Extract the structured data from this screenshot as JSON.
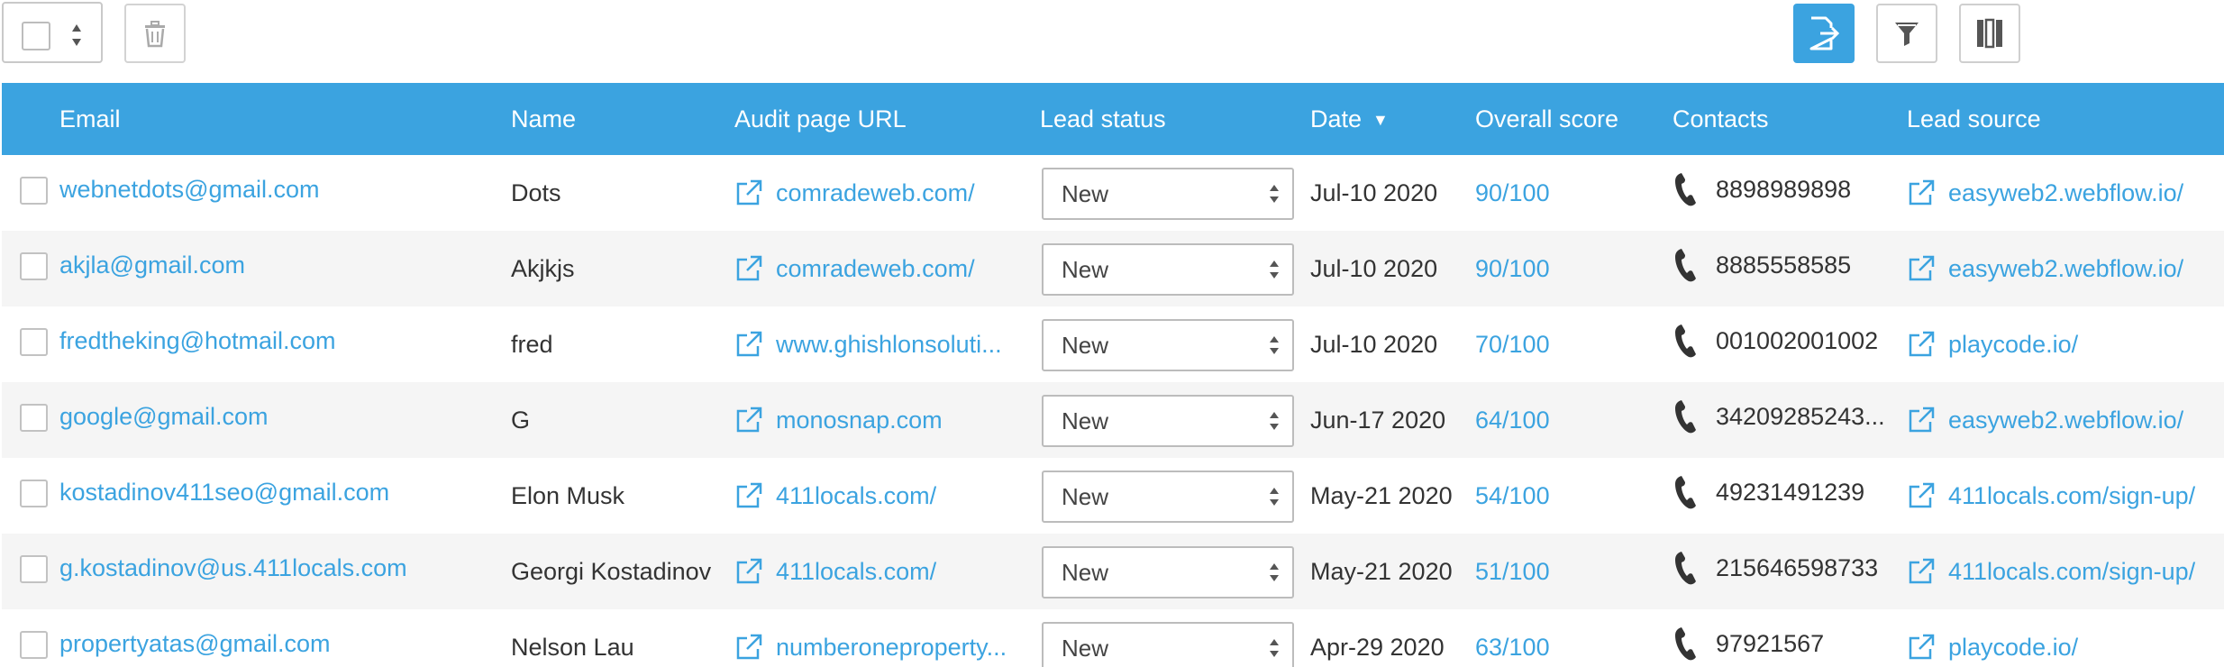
{
  "colors": {
    "accent": "#3ba3e0",
    "row_alt": "#f5f5f5"
  },
  "toolbar": {
    "select_icon": "checkbox-select-icon",
    "delete_icon": "trash-icon",
    "export_icon": "export-icon",
    "filter_icon": "filter-icon",
    "columns_icon": "columns-icon"
  },
  "table": {
    "headers": {
      "email": "Email",
      "name": "Name",
      "audit_url": "Audit page URL",
      "lead_status": "Lead status",
      "date": "Date",
      "date_sort": "▼",
      "overall_score": "Overall score",
      "contacts": "Contacts",
      "lead_source": "Lead source"
    },
    "rows": [
      {
        "email": "webnetdots@gmail.com",
        "name": "Dots",
        "url": "comradeweb.com/",
        "status": "New",
        "date": "Jul-10 2020",
        "score": "90/100",
        "phone": "8898989898",
        "source": "easyweb2.webflow.io/"
      },
      {
        "email": "akjla@gmail.com",
        "name": "Akjkjs",
        "url": "comradeweb.com/",
        "status": "New",
        "date": "Jul-10 2020",
        "score": "90/100",
        "phone": "8885558585",
        "source": "easyweb2.webflow.io/"
      },
      {
        "email": "fredtheking@hotmail.com",
        "name": "fred",
        "url": "www.ghishlonsoluti...",
        "status": "New",
        "date": "Jul-10 2020",
        "score": "70/100",
        "phone": "001002001002",
        "source": "playcode.io/"
      },
      {
        "email": "google@gmail.com",
        "name": "G",
        "url": "monosnap.com",
        "status": "New",
        "date": "Jun-17 2020",
        "score": "64/100",
        "phone": "34209285243...",
        "source": "easyweb2.webflow.io/"
      },
      {
        "email": "kostadinov411seo@gmail.com",
        "name": "Elon Musk",
        "url": "411locals.com/",
        "status": "New",
        "date": "May-21 2020",
        "score": "54/100",
        "phone": "49231491239",
        "source": "411locals.com/sign-up/"
      },
      {
        "email": "g.kostadinov@us.411locals.com",
        "name": "Georgi Kostadinov",
        "url": "411locals.com/",
        "status": "New",
        "date": "May-21 2020",
        "score": "51/100",
        "phone": "215646598733",
        "source": "411locals.com/sign-up/"
      },
      {
        "email": "propertyatas@gmail.com",
        "name": "Nelson Lau",
        "url": "numberoneproperty...",
        "status": "New",
        "date": "Apr-29 2020",
        "score": "63/100",
        "phone": "97921567",
        "source": "playcode.io/"
      }
    ]
  }
}
